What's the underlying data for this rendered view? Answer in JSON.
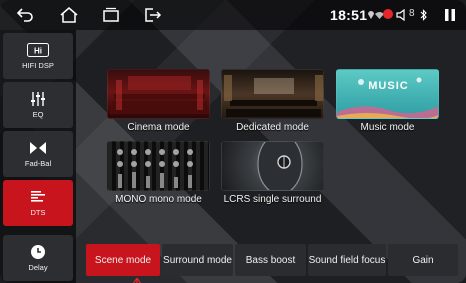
{
  "statusbar": {
    "time": "18:51",
    "battery_pct": "8",
    "icons": [
      "back-arrow-icon",
      "home-icon",
      "recent-apps-icon",
      "exit-icon",
      "location-icon",
      "wifi-icon",
      "record-icon",
      "volume-icon",
      "bluetooth-icon",
      "pause-icon"
    ]
  },
  "sidebar": {
    "items": [
      {
        "label": "HIFI DSP",
        "icon": "hifi-icon",
        "active": false
      },
      {
        "label": "EQ",
        "icon": "eq-sliders-icon",
        "active": false
      },
      {
        "label": "Fad-Bal",
        "icon": "fader-balance-icon",
        "active": false
      },
      {
        "label": "DTS",
        "icon": "dts-icon",
        "active": true
      },
      {
        "label": "Delay",
        "icon": "clock-icon",
        "active": false
      }
    ]
  },
  "modes": [
    {
      "label": "Cinema mode",
      "thumb": "cinema-thumbnail"
    },
    {
      "label": "Dedicated mode",
      "thumb": "dedicated-thumbnail"
    },
    {
      "label": "Music mode",
      "thumb": "music-thumbnail",
      "thumb_text": "MUSIC"
    },
    {
      "label": "MONO mono mode",
      "thumb": "mono-thumbnail"
    },
    {
      "label": "LCRS single surround",
      "thumb": "lcrs-thumbnail"
    }
  ],
  "tabs": [
    {
      "label": "Scene mode",
      "active": true
    },
    {
      "label": "Surround mode",
      "active": false
    },
    {
      "label": "Bass boost",
      "active": false
    },
    {
      "label": "Sound field focus",
      "active": false
    },
    {
      "label": "Gain",
      "active": false
    }
  ],
  "colors": {
    "accent": "#c8141c",
    "tile": "#2b2c2f"
  }
}
